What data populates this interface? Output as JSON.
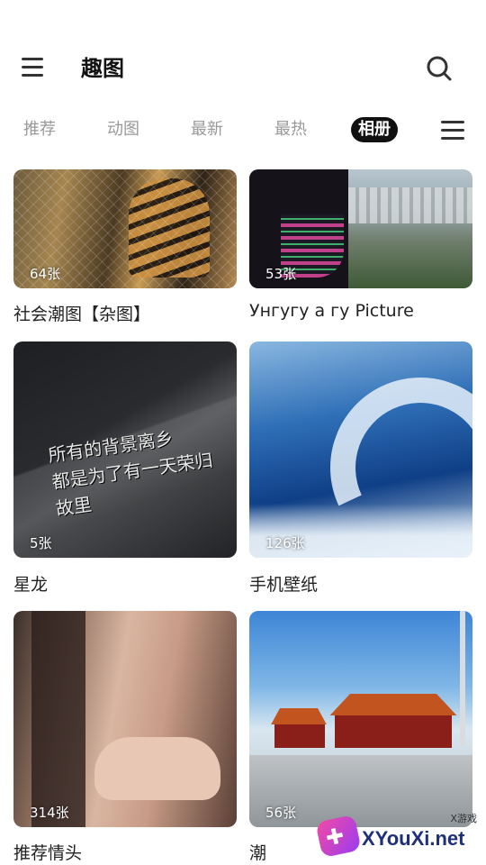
{
  "header": {
    "title": "趣图"
  },
  "tabs": [
    {
      "label": "推荐"
    },
    {
      "label": "动图"
    },
    {
      "label": "最新"
    },
    {
      "label": "最热"
    },
    {
      "label": "相册",
      "active": true
    }
  ],
  "albums": [
    {
      "title": "社会潮图【杂图】",
      "count": "64张"
    },
    {
      "title": "Унгугу а гу Picture",
      "count": "53张"
    },
    {
      "title": "星龙",
      "count": "5张",
      "image_text": "所有的背景离乡\n都是为了有一天荣归故里"
    },
    {
      "title": "手机壁纸",
      "count": "126张"
    },
    {
      "title": "推荐情头",
      "count": "314张"
    },
    {
      "title": "潮",
      "count": "56张"
    }
  ],
  "watermark": {
    "text": "XYouXi.net",
    "small": "X游戏"
  },
  "colors": {
    "active_tab_bg": "#111111",
    "inactive_tab": "#999999",
    "text": "#222222"
  }
}
